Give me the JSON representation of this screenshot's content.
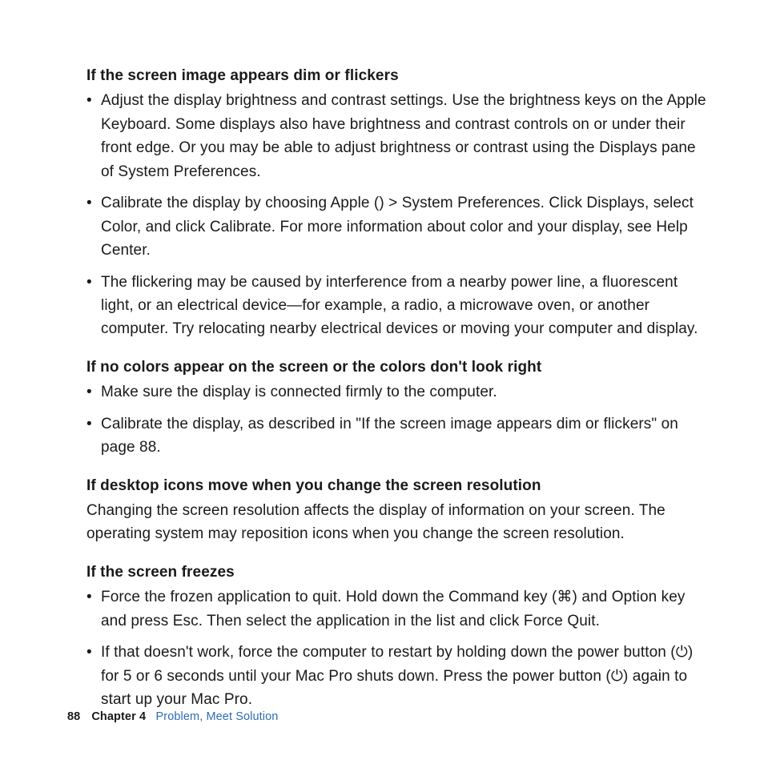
{
  "sections": {
    "dim": {
      "heading": "If the screen image appears dim or flickers",
      "b1": "Adjust the display brightness and contrast settings. Use the brightness keys on the Apple Keyboard. Some displays also have brightness and contrast controls on or under their front edge. Or you may be able to adjust brightness or contrast using the Displays pane of System Preferences.",
      "b2_pre": "Calibrate the display by choosing Apple (",
      "b2_post": ") > System Preferences. Click Displays, select Color, and click Calibrate. For more information about color and your display, see Help Center.",
      "b3": "The flickering may be caused by interference from a nearby power line, a fluorescent light, or an electrical device—for example, a radio, a microwave oven, or another computer. Try relocating nearby electrical devices or moving your computer and display."
    },
    "colors": {
      "heading": "If no colors appear on the screen or the colors don't look right",
      "b1": "Make sure the display is connected firmly to the computer.",
      "b2": "Calibrate the display, as described in \"If the screen image appears dim or flickers\" on page 88."
    },
    "icons": {
      "heading": "If desktop icons move when you change the screen resolution",
      "p": "Changing the screen resolution affects the display of information on your screen. The operating system may reposition icons when you change the screen resolution."
    },
    "freeze": {
      "heading": "If the screen freezes",
      "b1_pre": "Force the frozen application to quit. Hold down the Command key (",
      "b1_post": ") and Option key and press Esc. Then select the application in the list and click Force Quit.",
      "b2_pre": "If that doesn't work, force the computer to restart by holding down the power button (",
      "b2_mid": ") for 5 or 6 seconds until your Mac Pro shuts down. Press the power button (",
      "b2_post": ") again to start up your Mac Pro."
    }
  },
  "footer": {
    "page": "88",
    "chapter": "Chapter 4",
    "title": "Problem, Meet Solution"
  },
  "icons": {
    "apple": "",
    "command": "⌘",
    "power": "⏻"
  }
}
